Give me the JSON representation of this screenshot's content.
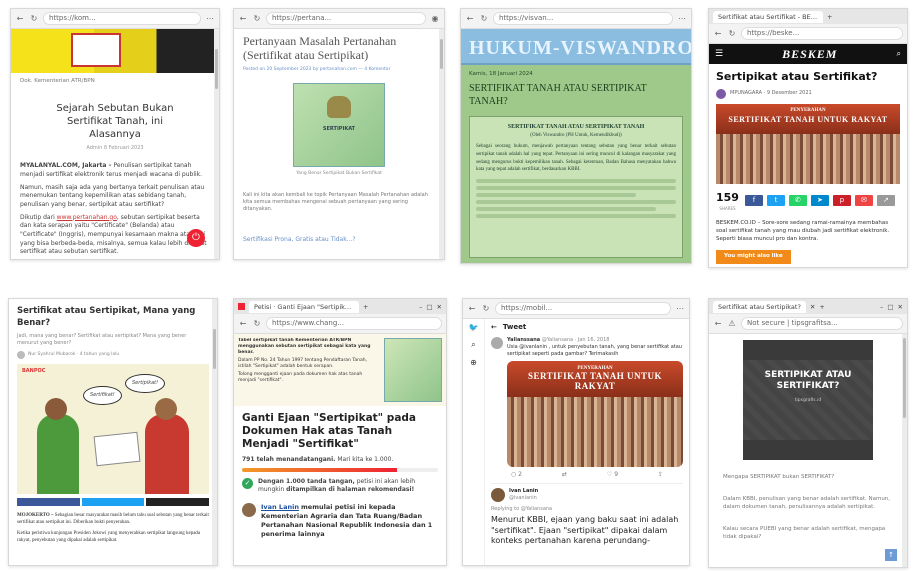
{
  "t1": {
    "url": "https://kom...",
    "caption": "Dok. Kementerian ATR/BPN",
    "title": "Sejarah Sebutan Bukan Sertifikat Tanah, ini Alasannya",
    "meta": "Admin   8 Februari 2023",
    "para1_lead": "MYALANYAL.COM, Jakarta –",
    "para1": "Penulisan sertipikat tanah menjadi sertifikat elektronik terus menjadi wacana di publik.",
    "para2": "Namun, masih saja ada yang bertanya terkait penulisan atau menemukan tentang kepemilikan atas sebidang tanah, penulisan yang benar, sertipikat atau sertifikat?",
    "para3_a": "Dikutip dari",
    "para3_link": "www.pertanahan.go",
    "para3_b": ", sebutan sertipikat beserta dan kata serapan yaitu \"Certificate\" (Belanda) atau \"Certificate\" (Inggris), mempunyai kesamaan makna atas arti yang bisa berbeda-beda, misalnya, semua kalau lebih disebut sertifikat atau sebutan sertifikat."
  },
  "t2": {
    "url": "https://pertana...",
    "title": "Pertanyaan Masalah Pertanahan (Sertifikat atau Sertipikat)",
    "meta": "Posted on 20 September 2023 by pertanahan.com — 4 Komentar",
    "cert_text": "SERTIPIKAT",
    "caption": "Yang Benar Sertipikat Bukan Sertifikat",
    "body": "Kali ini kita akan kembali ke topik Pertanyaan Masalah Pertanahan adalah kita semua membahas mengenai sebuah pertanyaan yang sering ditanyakan.",
    "link": "Sertifikasi Prona, Gratis atau Tidak...?"
  },
  "t3": {
    "url": "https://visvan...",
    "page_title": "HUKUM-VISWANDRO",
    "date": "Kamis, 18 Januari 2024",
    "title": "SERTIFIKAT TANAH ATAU SERTIPIKAT TANAH?",
    "box_title": "SERTIFIKAT TANAH ATAU SERTIPIKAT TANAH",
    "box_sub": "(Oleh Viswandro (PH Untuk, Kemendikbud))",
    "box_body": "Sebagai seorang hukum, menjawab pertanyaan tentang sebutan yang benar terkait sebutan sertipikat tanah adalah hal yang tepat. Pertanyaan ini sering muncul di kalangan masyarakat yang sedang mengurus bukti kepemilikan tanah. Sebagai ketentuan, Badan Bahasa menyatakan bahwa kata yang tepat adalah sertifikat, berdasarkan KBBI."
  },
  "t4": {
    "tab": "Sertifikat atau Sertifikat - BESKEM",
    "url": "https://beske...",
    "brand": "BESKEM",
    "title": "Sertipikat atau Sertifikat?",
    "byline": "MPUNAGARA · 9 Desember 2021",
    "banner_top": "PENYERAHAN",
    "banner": "SERTIFIKAT TANAH UNTUK RAKYAT",
    "shares": "159",
    "shares_label": "SHARES",
    "body": "BESKEM.CO.ID – Sore-sore sedang ramai-ramainya membahas soal sertifikat tanah yang mau diubah jadi sertifikat elektronik. Seperti biasa muncul pro dan kontra.",
    "cta": "You might also like"
  },
  "t5": {
    "title": "Sertifikat atau Sertipikat, Mana yang Benar?",
    "sub": "Jadi, mana yang benar? Sertifikat atau sertipikat? Mana yang bener menurut yang bener?",
    "byline": "Nur Syahrul Mubarok · 4 tahun yang lalu",
    "logo": "BANPOC",
    "bubble1": "Sertifikat!",
    "bubble2": "Sertipikat!",
    "body_lead": "MOJOKERTO –",
    "body": "Sebagian besar masyarakat masih belum tahu soal sebutan yang benar terkait sertifikat atau sertipikat ini. Diberikan bukti penyerahan.",
    "body2": "Ketika peristiwa kunjungan Presiden Jokowi yang menyerahkan sertipikat langsung kepada rakyat, penyebutan yang dipakai adalah sertipikat."
  },
  "t6": {
    "tab": "Petisi · Ganti Ejaan \"Sertipikat\" p",
    "url": "https://www.chang...",
    "snip1": "Tabel sertipikat tanah Kementerian ATR/BPN menggunakan sebutan sertipikat sebagai kata yang benar.",
    "snip2": "Dalam PP No. 24 Tahun 1997 tentang Pendaftaran Tanah, istilah \"Sertipikat\" adalah bentuk serapan.",
    "snip3": "Tolong mengganti ejaan pada dokumen hak atas tanah menjadi \"sertifikat\".",
    "title": "Ganti Ejaan \"Sertipikat\" pada Dokumen Hak atas Tanah Menjadi \"Sertifikat\"",
    "signed": "791 telah menandatangani.",
    "signed_rest": "Mari kita ke 1.000.",
    "progress": 0.79,
    "goal_bold": "Dengan 1.000 tanda tangan,",
    "goal_rest": "petisi ini akan lebih mungkin",
    "goal_bold2": "ditampilkan di halaman rekomendasi!",
    "starter": "Ivan Lanin",
    "starter_rest": "memulai petisi ini kepada Kementerian Agraria dan Tata Ruang/Badan Pertanahan Nasional Republik Indonesia dan",
    "recipients": "1 penerima lainnya"
  },
  "t7": {
    "url": "https://mobil...",
    "header": "Tweet",
    "user1": "Yalianssana",
    "handle1": "@Yaliansana · Jan 16, 2018",
    "tweet1": "Usia @ivanlanin , untuk penyebutan tanah, yang benar sertifikat atau sertipikat seperti pada gambar? Terimakasih",
    "banner_top": "PENYERAHAN",
    "banner": "SERTIFIKAT TANAH UNTUK RAKYAT",
    "likes": "9",
    "replies": "2",
    "user2": "Ivan Lanin",
    "handle2": "@ivanlanin",
    "replying": "Replying to @Yaliansana",
    "reply": "Menurut KBBI, ejaan yang baku saat ini adalah \"sertifikat\". Ejaan \"sertipikat\" dipakai dalam konteks pertanahan karena perundang-"
  },
  "t8": {
    "tab": "Sertifikat atau Sertipikat?",
    "secure": "Not secure | tipsgrafitsa...",
    "cover": "SERTIPIKAT ATAU SERTIFIKAT?",
    "cover_sub": "tipsgrafis.id",
    "q": "Mengapa SERTIPIKAT bukan SERTIFIKAT?",
    "p1": "Dalam KBBI, penulisan yang benar adalah sertifikat. Namun, dalam dokumen tanah, penulisannya adalah sertipikat.",
    "p2": "Kalau secara PUEBI yang benar adalah sertifikat, mengapa tidak dipakai?"
  }
}
